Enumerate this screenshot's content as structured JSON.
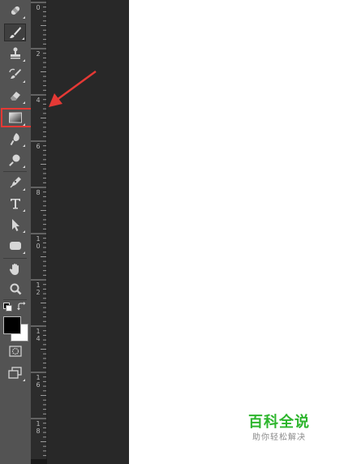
{
  "app": "Adobe Photoshop",
  "toolbar": {
    "tools": [
      {
        "name": "spot-healing-brush-tool",
        "icon": "bandage-icon"
      },
      {
        "name": "brush-tool",
        "icon": "brush-icon",
        "active": true
      },
      {
        "name": "clone-stamp-tool",
        "icon": "stamp-icon"
      },
      {
        "name": "history-brush-tool",
        "icon": "history-brush-icon"
      },
      {
        "name": "eraser-tool",
        "icon": "eraser-icon"
      },
      {
        "name": "gradient-tool",
        "icon": "gradient-icon",
        "highlighted": true
      },
      {
        "name": "blur-tool",
        "icon": "blur-drop-icon"
      },
      {
        "name": "dodge-tool",
        "icon": "dodge-icon"
      },
      {
        "name": "pen-tool",
        "icon": "pen-nib-icon"
      },
      {
        "name": "type-tool",
        "icon": "type-t-icon"
      },
      {
        "name": "path-selection-tool",
        "icon": "arrow-pointer-icon"
      },
      {
        "name": "rectangle-tool",
        "icon": "rounded-rectangle-icon"
      },
      {
        "name": "hand-tool",
        "icon": "hand-icon"
      },
      {
        "name": "zoom-tool",
        "icon": "magnifier-icon"
      }
    ],
    "foreground_color": "#000000",
    "background_color": "#ffffff"
  },
  "ruler": {
    "labels": [
      "0",
      "2",
      "4",
      "6",
      "8",
      "1\n0",
      "1\n2",
      "1\n4",
      "1\n6",
      "1\n8"
    ]
  },
  "annotation": {
    "arrow_color": "#e53935",
    "highlight_color": "#e53935"
  },
  "watermark": {
    "title": "百科全说",
    "subtitle": "助你轻松解决",
    "color": "#2cb52c"
  }
}
